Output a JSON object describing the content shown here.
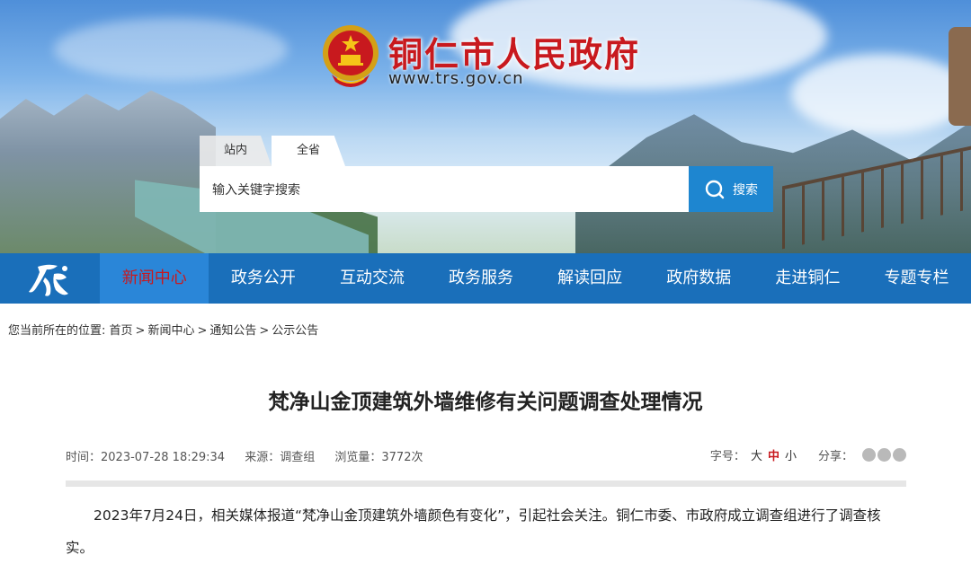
{
  "header": {
    "site_name": "铜仁市人民政府",
    "site_url": "www.trs.gov.cn"
  },
  "search": {
    "tabs": [
      "站内",
      "全省"
    ],
    "placeholder": "输入关键字搜索",
    "button_label": "搜索"
  },
  "nav": {
    "items": [
      "新闻中心",
      "政务公开",
      "互动交流",
      "政务服务",
      "解读回应",
      "政府数据",
      "走进铜仁",
      "专题专栏"
    ],
    "active_index": 0
  },
  "breadcrumb": {
    "prefix": "您当前所在的位置:",
    "items": [
      "首页",
      "新闻中心",
      "通知公告",
      "公示公告"
    ]
  },
  "article": {
    "title": "梵净山金顶建筑外墙维修有关问题调查处理情况",
    "time": "时间：2023-07-28 18:29:34",
    "source": "来源：调查组",
    "views": "浏览量：3772次",
    "font_size_label": "字号：",
    "font_sizes": [
      "大",
      "中",
      "小"
    ],
    "share_label": "分享：",
    "body": "2023年7月24日，相关媒体报道“梵净山金顶建筑外墙颜色有变化”，引起社会关注。铜仁市委、市政府成立调查组进行了调查核实。"
  },
  "colors": {
    "nav_bg": "#1a6fba",
    "accent_red": "#c8191e",
    "search_button": "#1e86d0"
  }
}
